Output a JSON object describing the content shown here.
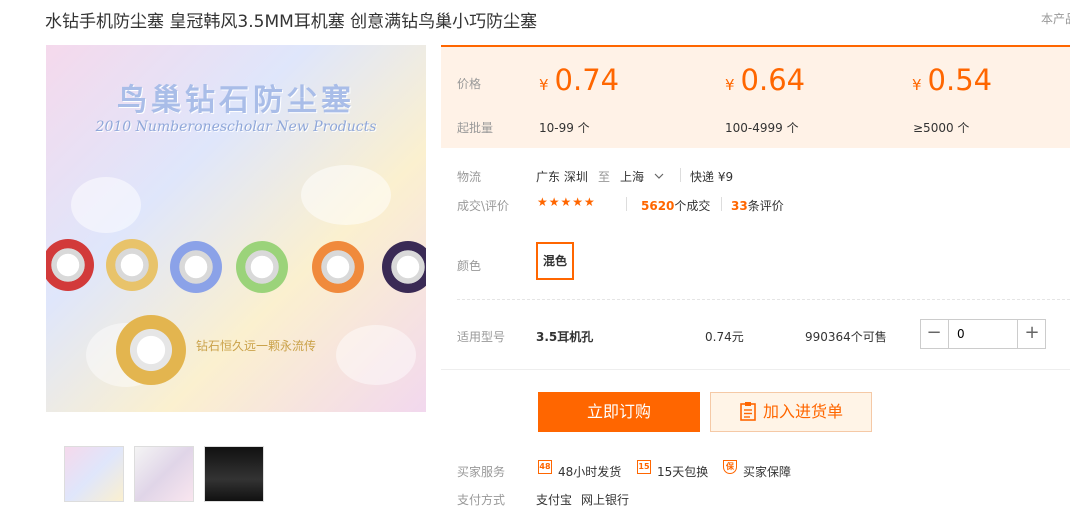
{
  "title": "水钻手机防尘塞 皇冠韩风3.5MM耳机塞 创意满钻鸟巢小巧防尘塞",
  "top_right_note": "本产品",
  "main_image": {
    "banner": "鸟巢钻石防尘塞",
    "subtitle": "2010 Numberonescholar  New Products",
    "slogan": "钻石恒久远一颗永流传"
  },
  "price": {
    "price_label": "价格",
    "min_qty_label": "起批量",
    "currency": "¥",
    "tiers": [
      {
        "price": "0.74",
        "qty": "10-99 个"
      },
      {
        "price": "0.64",
        "qty": "100-4999 个"
      },
      {
        "price": "0.54",
        "qty": "≥5000 个"
      }
    ]
  },
  "logistics": {
    "label": "物流",
    "from": "广东 深圳",
    "to_word": "至",
    "to": "上海",
    "method": "快递 ¥9"
  },
  "deals": {
    "label": "成交\\评价",
    "stars": "★★★★★",
    "count": "5620",
    "count_suffix": "个成交",
    "reviews": "33",
    "reviews_suffix": "条评价"
  },
  "color": {
    "label": "颜色",
    "option": "混色"
  },
  "model": {
    "label": "适用型号",
    "name": "3.5耳机孔",
    "unit_price": "0.74元",
    "stock": "990364个可售",
    "quantity": "0",
    "minus": "−",
    "plus": "+"
  },
  "actions": {
    "buy_now": "立即订购",
    "add_to_list": "加入进货单"
  },
  "services": {
    "label": "买家服务",
    "items": [
      {
        "icon_text": "48",
        "label": "48小时发货"
      },
      {
        "icon_text": "15",
        "label": "15天包换"
      },
      {
        "icon_text": "保",
        "label": "买家保障"
      }
    ]
  },
  "payment": {
    "label": "支付方式",
    "methods": [
      "支付宝",
      "网上银行"
    ]
  },
  "colors": {
    "accent": "#ff6600",
    "price_bg": "#fff2e7"
  }
}
